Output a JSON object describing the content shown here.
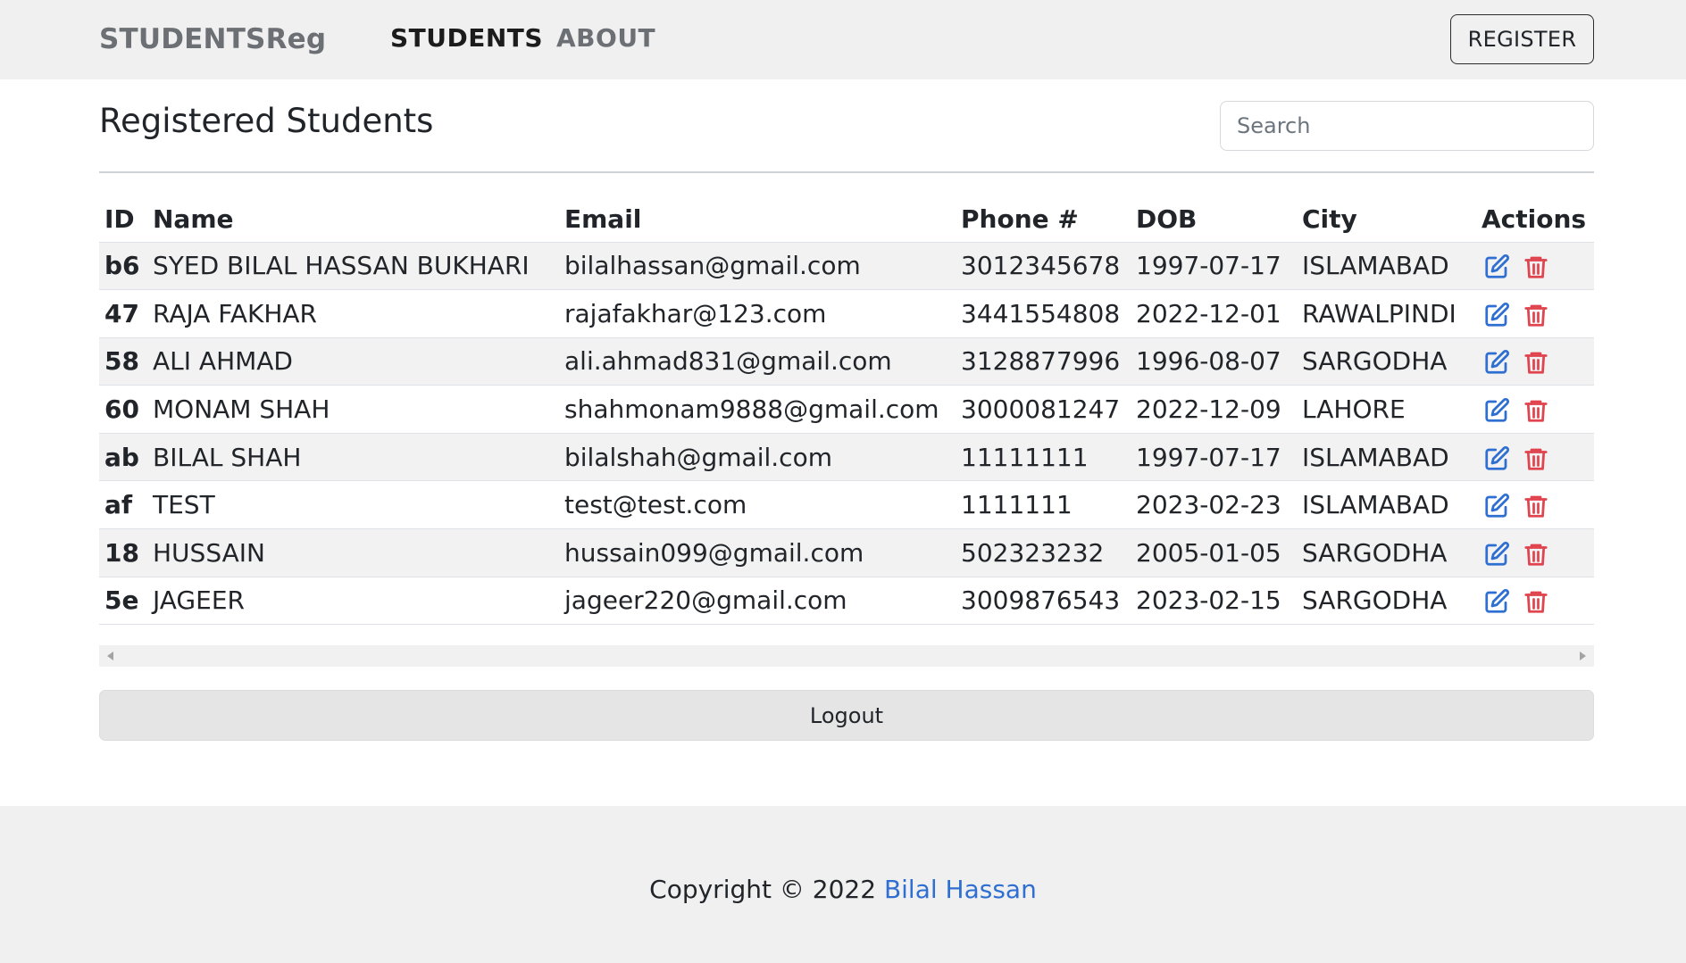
{
  "navbar": {
    "brand": "STUDENTSReg",
    "links": [
      "STUDENTS",
      "ABOUT"
    ],
    "register_label": "REGISTER"
  },
  "header": {
    "title": "Registered Students",
    "search_placeholder": "Search"
  },
  "table": {
    "columns": [
      "ID",
      "Name",
      "Email",
      "Phone #",
      "DOB",
      "City",
      "Actions"
    ],
    "rows": [
      {
        "id": "b6",
        "name": "SYED BILAL HASSAN BUKHARI",
        "email": "bilalhassan@gmail.com",
        "phone": "3012345678",
        "dob": "1997-07-17",
        "city": "ISLAMABAD"
      },
      {
        "id": "47",
        "name": "RAJA FAKHAR",
        "email": "rajafakhar@123.com",
        "phone": "3441554808",
        "dob": "2022-12-01",
        "city": "RAWALPINDI"
      },
      {
        "id": "58",
        "name": "ALI AHMAD",
        "email": "ali.ahmad831@gmail.com",
        "phone": "3128877996",
        "dob": "1996-08-07",
        "city": "SARGODHA"
      },
      {
        "id": "60",
        "name": "MONAM SHAH",
        "email": "shahmonam9888@gmail.com",
        "phone": "3000081247",
        "dob": "2022-12-09",
        "city": "LAHORE"
      },
      {
        "id": "ab",
        "name": "BILAL SHAH",
        "email": "bilalshah@gmail.com",
        "phone": "11111111",
        "dob": "1997-07-17",
        "city": "ISLAMABAD"
      },
      {
        "id": "af",
        "name": "TEST",
        "email": "test@test.com",
        "phone": "1111111",
        "dob": "2023-02-23",
        "city": "ISLAMABAD"
      },
      {
        "id": "18",
        "name": "HUSSAIN",
        "email": "hussain099@gmail.com",
        "phone": "502323232",
        "dob": "2005-01-05",
        "city": "SARGODHA"
      },
      {
        "id": "5e",
        "name": "JAGEER",
        "email": "jageer220@gmail.com",
        "phone": "3009876543",
        "dob": "2023-02-15",
        "city": "SARGODHA"
      }
    ],
    "action_icons": [
      "edit-icon",
      "trash-icon"
    ],
    "edit_color": "#2f6fd1",
    "delete_color": "#e0454f"
  },
  "logout_label": "Logout",
  "footer": {
    "prefix": "Copyright © 2022 ",
    "author": "Bilal Hassan"
  }
}
